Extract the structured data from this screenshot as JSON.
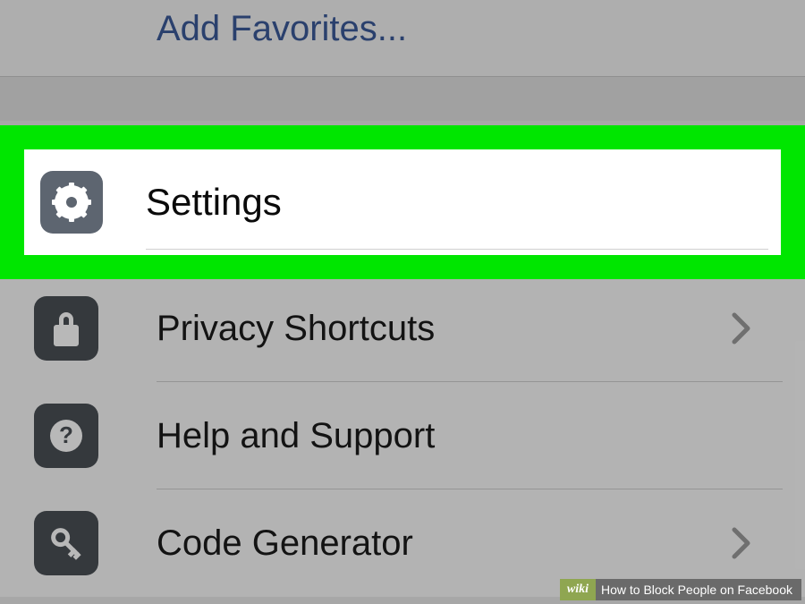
{
  "favorites": {
    "label": "Add Favorites..."
  },
  "menu": {
    "settings": {
      "label": "Settings"
    },
    "privacy": {
      "label": "Privacy Shortcuts"
    },
    "help": {
      "label": "Help and Support"
    },
    "codegen": {
      "label": "Code Generator"
    }
  },
  "watermark": {
    "wiki": "wiki",
    "rest": "How to Block People on Facebook"
  }
}
